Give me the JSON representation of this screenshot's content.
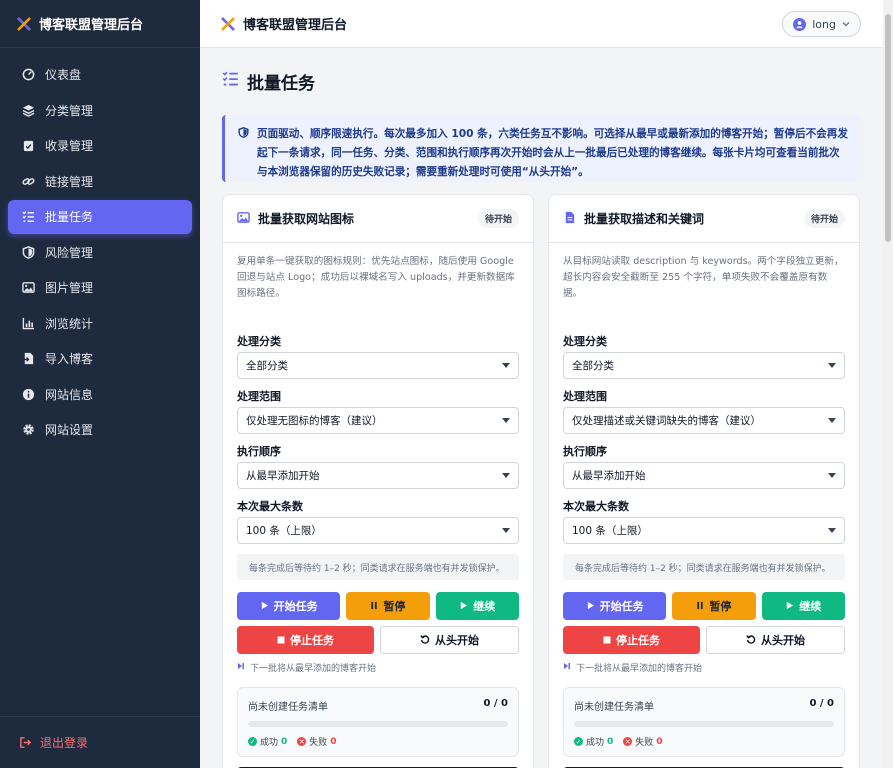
{
  "app": {
    "title": "博客联盟管理后台"
  },
  "sidebar": {
    "items": [
      {
        "label": "仪表盘",
        "icon": "gauge-icon"
      },
      {
        "label": "分类管理",
        "icon": "layers-icon"
      },
      {
        "label": "收录管理",
        "icon": "clipboard-check-icon"
      },
      {
        "label": "链接管理",
        "icon": "link-icon"
      },
      {
        "label": "批量任务",
        "icon": "list-check-icon",
        "active": true
      },
      {
        "label": "风险管理",
        "icon": "shield-icon"
      },
      {
        "label": "图片管理",
        "icon": "image-icon"
      },
      {
        "label": "浏览统计",
        "icon": "bar-chart-icon"
      },
      {
        "label": "导入博客",
        "icon": "file-import-icon"
      },
      {
        "label": "网站信息",
        "icon": "info-icon"
      },
      {
        "label": "网站设置",
        "icon": "gear-icon"
      }
    ],
    "logout_label": "退出登录"
  },
  "topbar": {
    "title": "博客联盟管理后台",
    "user": "long"
  },
  "page": {
    "title": "批量任务",
    "notice": "页面驱动、顺序限速执行。每次最多加入 100 条，六类任务互不影响。可选择从最早或最新添加的博客开始；暂停后不会再发起下一条请求，同一任务、分类、范围和执行顺序再次开始时会从上一批最后已处理的博客继续。每张卡片均可查看当前批次与本浏览器保留的历史失败记录；需要重新处理时可使用“从头开始”。"
  },
  "cards": [
    {
      "title": "批量获取网站图标",
      "icon": "image-icon",
      "status": "待开始",
      "description": "复用单条一键获取的图标规则：优先站点图标，随后使用 Google 回退与站点 Logo；成功后以裸域名写入 uploads，并更新数据库图标路径。",
      "category_label": "处理分类",
      "category_value": "全部分类",
      "scope_label": "处理范围",
      "scope_value": "仅处理无图标的博客（建议）",
      "order_label": "执行顺序",
      "order_value": "从最早添加开始",
      "max_label": "本次最大条数",
      "max_value": "100 条（上限）",
      "hint": "每条完成后等待约 1–2 秒；同类请求在服务端也有并发锁保护。",
      "btn_start": "开始任务",
      "btn_pause": "暂停",
      "btn_resume": "继续",
      "btn_stop": "停止任务",
      "btn_restart": "从头开始",
      "next_batch": "下一批将从最早添加的博客开始",
      "progress_label": "尚未创建任务清单",
      "progress_count": "0 / 0",
      "progress_fraction": 0,
      "success_label": "成功",
      "success_count": "0",
      "fail_label": "失败",
      "fail_count": "0"
    },
    {
      "title": "批量获取描述和关键词",
      "icon": "file-text-icon",
      "status": "待开始",
      "description": "从目标网站读取 description 与 keywords。两个字段独立更新，超长内容会安全截断至 255 个字符，单项失败不会覆盖原有数据。",
      "category_label": "处理分类",
      "category_value": "全部分类",
      "scope_label": "处理范围",
      "scope_value": "仅处理描述或关键词缺失的博客（建议）",
      "order_label": "执行顺序",
      "order_value": "从最早添加开始",
      "max_label": "本次最大条数",
      "max_value": "100 条（上限）",
      "hint": "每条完成后等待约 1–2 秒；同类请求在服务端也有并发锁保护。",
      "btn_start": "开始任务",
      "btn_pause": "暂停",
      "btn_resume": "继续",
      "btn_stop": "停止任务",
      "btn_restart": "从头开始",
      "next_batch": "下一批将从最早添加的博客开始",
      "progress_label": "尚未创建任务清单",
      "progress_count": "0 / 0",
      "progress_fraction": 0,
      "success_label": "成功",
      "success_count": "0",
      "fail_label": "失败",
      "fail_count": "0"
    }
  ],
  "colors": {
    "sidebar_bg": "#1e2a3e",
    "accent": "#6366f1",
    "warning": "#f59e0b",
    "success": "#10b981",
    "danger": "#ef4444"
  }
}
